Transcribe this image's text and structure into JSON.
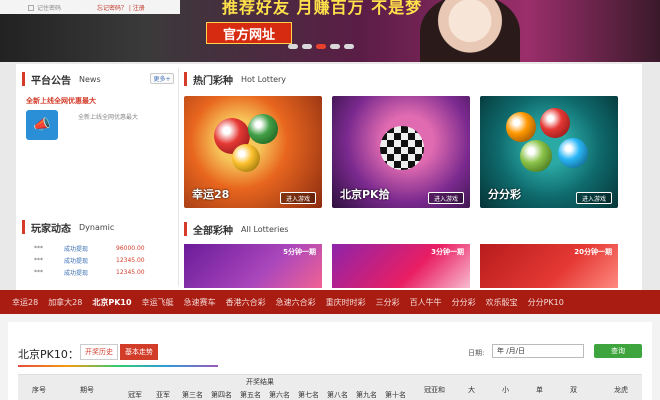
{
  "banner": {
    "remember_label": "记住密码",
    "links": "忘记密码？ | 注册",
    "slogan": "推荐好友 月赚百万 不是梦",
    "site_button": "官方网址"
  },
  "notice": {
    "title": "平台公告",
    "title_en": "News",
    "more": "更多+",
    "headline": "全新上线全网优惠最大",
    "text": "全新上线全网优惠最大"
  },
  "hot": {
    "title": "热门彩种",
    "title_en": "Hot Lottery",
    "enter": "进入游戏",
    "cards": [
      {
        "name": "幸运28"
      },
      {
        "name": "北京PK拾"
      },
      {
        "name": "分分彩"
      }
    ]
  },
  "dynamic": {
    "title": "玩家动态",
    "title_en": "Dynamic",
    "rows": [
      {
        "user": "***",
        "action": "成功提现",
        "amount": "96000.00"
      },
      {
        "user": "***",
        "action": "成功提现",
        "amount": "12345.00"
      },
      {
        "user": "***",
        "action": "成功提现",
        "amount": "12345.00"
      }
    ]
  },
  "all": {
    "title": "全部彩种",
    "title_en": "All Lotteries",
    "tags": [
      "5分钟一期",
      "3分钟一期",
      "20分钟一期"
    ]
  },
  "nav": {
    "items": [
      "幸运28",
      "加拿大28",
      "北京PK10",
      "幸运飞艇",
      "急速赛车",
      "香港六合彩",
      "急速六合彩",
      "重庆时时彩",
      "三分彩",
      "百人牛牛",
      "分分彩",
      "欢乐骰宝",
      "分分PK10"
    ],
    "active_index": 2
  },
  "results": {
    "title": "北京PK10：",
    "tab_history": "开奖历史",
    "tab_trend": "基本走势",
    "date_label": "日期:",
    "date_value": "年 /月/日",
    "query": "查询",
    "headers": {
      "seq": "序号",
      "issue": "期号",
      "group": "开奖结果",
      "places": [
        "冠军",
        "亚军",
        "第三名",
        "第四名",
        "第五名",
        "第六名",
        "第七名",
        "第八名",
        "第九名",
        "第十名"
      ],
      "sum": "冠亚和",
      "big": "大",
      "small": "小",
      "odd": "单",
      "even": "双",
      "dragon": "龙虎"
    }
  }
}
